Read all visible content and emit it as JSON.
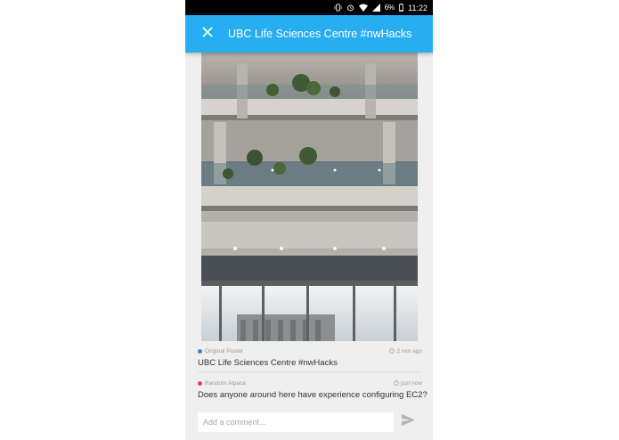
{
  "status_bar": {
    "battery_percent": "6%",
    "time": "11:22",
    "icons": [
      "vibrate-icon",
      "alarm-icon",
      "wifi-icon",
      "signal-icon",
      "battery-icon"
    ]
  },
  "app_bar": {
    "close_icon": "close-icon",
    "title": "UBC Life Sciences Centre #nwHacks",
    "color": "#27aef0"
  },
  "comments": [
    {
      "author": "Original Poster",
      "author_color": "#4a7fd6",
      "time": "2 min ago",
      "text": "UBC Life Sciences Centre #nwHacks"
    },
    {
      "author": "Random Alpaca",
      "author_color": "#e23f6d",
      "time": "just now",
      "text": "Does anyone around here have experience configuring EC2?"
    }
  ],
  "composer": {
    "placeholder": "Add a comment...",
    "send_icon": "send-icon"
  }
}
